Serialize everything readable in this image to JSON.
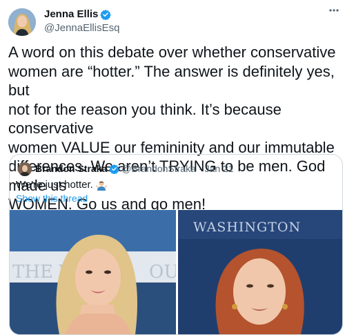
{
  "author": {
    "display_name": "Jenna Ellis",
    "handle": "@JennaEllisEsq"
  },
  "tweet": {
    "text": "A word on this debate over whether conservative\nwomen are “hotter.” The answer is definitely yes, but\nnot for the reason you think. It’s because conservative\nwomen VALUE our femininity and our immutable\ndifferences. We aren’t TRYING to be men. God made us\nWOMEN. Go us and go men!"
  },
  "quoted": {
    "display_name": "Brandon Straka",
    "handle": "@BrandonStraka",
    "separator": "·",
    "date": "Jan 21",
    "text": "We're just hotter.",
    "emoji": "man-shrugging-emoji",
    "thread_link": "Show this thread",
    "media_text": "WASHINGTON"
  },
  "icons": {
    "verified": "verified-badge-icon",
    "more": "more-options-icon"
  },
  "colors": {
    "verified_blue": "#1d9bf0",
    "link_blue": "#1d9bf0",
    "secondary_text": "#536471",
    "border": "#cfd9de"
  }
}
